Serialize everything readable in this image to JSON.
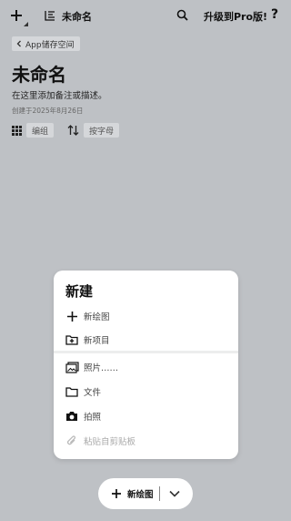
{
  "topbar": {
    "doc_title": "未命名",
    "upgrade_label": "升级到Pro版!",
    "help_label": "?"
  },
  "header": {
    "back_label": "App储存空间",
    "title": "未命名",
    "description": "在这里添加备注或描述。",
    "created": "创建于2025年8月26日"
  },
  "toolbar": {
    "group_label": "编组",
    "sort_label": "按字母"
  },
  "new_menu": {
    "title": "新建",
    "items": [
      {
        "label": "新绘图",
        "icon": "plus-icon",
        "enabled": true
      },
      {
        "label": "新项目",
        "icon": "folder-plus-icon",
        "enabled": true
      },
      {
        "label": "照片……",
        "icon": "photos-icon",
        "enabled": true
      },
      {
        "label": "文件",
        "icon": "folder-icon",
        "enabled": true
      },
      {
        "label": "拍照",
        "icon": "camera-icon",
        "enabled": true
      },
      {
        "label": "粘贴自剪贴板",
        "icon": "paperclip-icon",
        "enabled": false
      }
    ]
  },
  "fab": {
    "label": "新绘图"
  }
}
